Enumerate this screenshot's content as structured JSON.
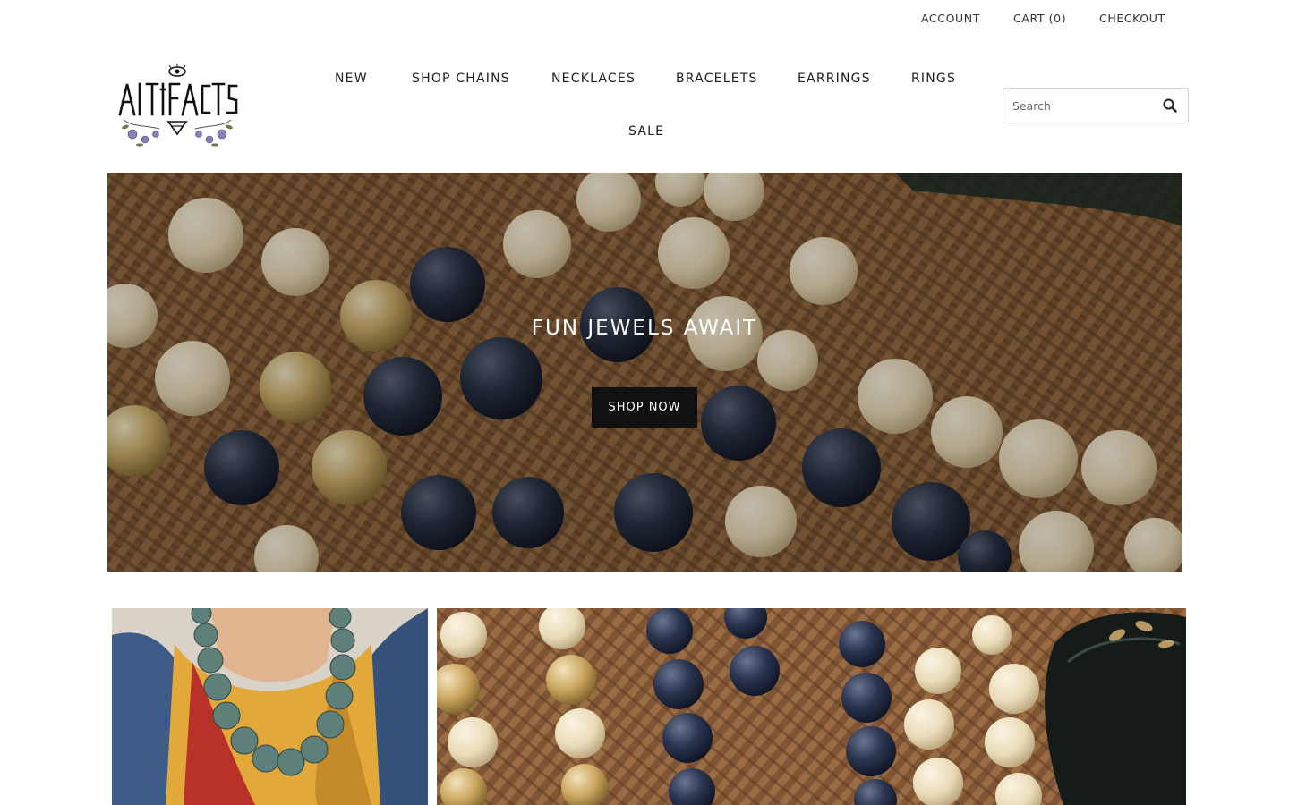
{
  "header": {
    "account_label": "ACCOUNT",
    "cart_label": "CART (0)",
    "checkout_label": "CHECKOUT"
  },
  "logo": {
    "text": "ARTIFACTS"
  },
  "nav": {
    "items": [
      {
        "label": "NEW"
      },
      {
        "label": "SHOP CHAINS"
      },
      {
        "label": "NECKLACES"
      },
      {
        "label": "BRACELETS"
      },
      {
        "label": "EARRINGS"
      },
      {
        "label": "RINGS"
      },
      {
        "label": "SALE"
      }
    ]
  },
  "search": {
    "placeholder": "Search",
    "icon": "search-icon"
  },
  "hero": {
    "title": "FUN JEWELS AWAIT",
    "button_label": "SHOP NOW"
  },
  "colors": {
    "text": "#222222",
    "button_bg": "#111111",
    "button_text": "#ffffff",
    "rattan": "#8a5f3a",
    "bead_cream": "#e9dcc0",
    "bead_navy": "#2a3244"
  }
}
